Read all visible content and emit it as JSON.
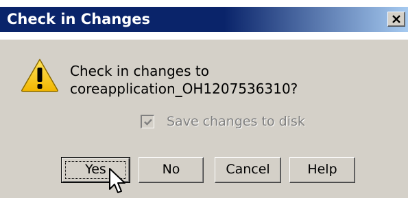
{
  "window": {
    "title": "Check in Changes"
  },
  "icons": {
    "close": "close-icon",
    "warning": "warning-icon",
    "cursor": "mouse-pointer-icon",
    "checkmark": "checkmark-icon"
  },
  "message": {
    "line1": "Check in changes to",
    "line2": "coreapplication_OH1207536310?"
  },
  "save_option": {
    "label": "Save changes to disk",
    "checked": true,
    "disabled": true
  },
  "buttons": {
    "yes": "Yes",
    "no": "No",
    "cancel": "Cancel",
    "help": "Help"
  },
  "colors": {
    "title_bar": "#0a246a",
    "dialog_face": "#d4d0c8",
    "warning_yellow": "#f5c400"
  }
}
